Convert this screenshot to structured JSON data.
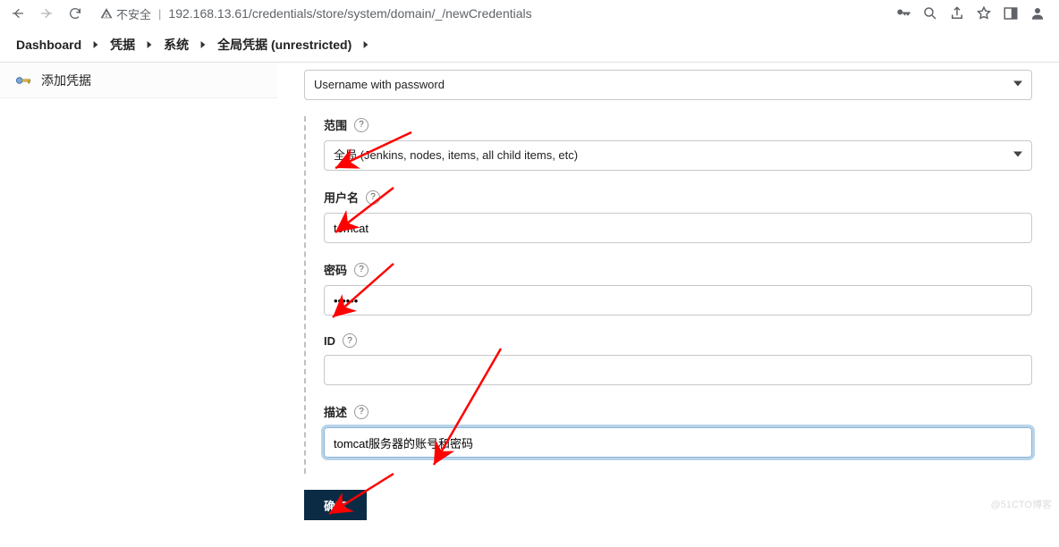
{
  "browser": {
    "insecure_label": "不安全",
    "url": "192.168.13.61/credentials/store/system/domain/_/newCredentials"
  },
  "breadcrumb": {
    "items": [
      "Dashboard",
      "凭据",
      "系统",
      "全局凭据 (unrestricted)"
    ]
  },
  "sidebar": {
    "add_label": "添加凭据"
  },
  "kind_select": {
    "value": "Username with password"
  },
  "fields": {
    "scope": {
      "label": "范围",
      "value": "全局 (Jenkins, nodes, items, all child items, etc)"
    },
    "username": {
      "label": "用户名",
      "value": "tomcat"
    },
    "password": {
      "label": "密码",
      "value": "••••••"
    },
    "id": {
      "label": "ID",
      "value": ""
    },
    "description": {
      "label": "描述",
      "value": "tomcat服务器的账号和密码"
    }
  },
  "submit_label": "确定",
  "watermark": "@51CTO博客"
}
